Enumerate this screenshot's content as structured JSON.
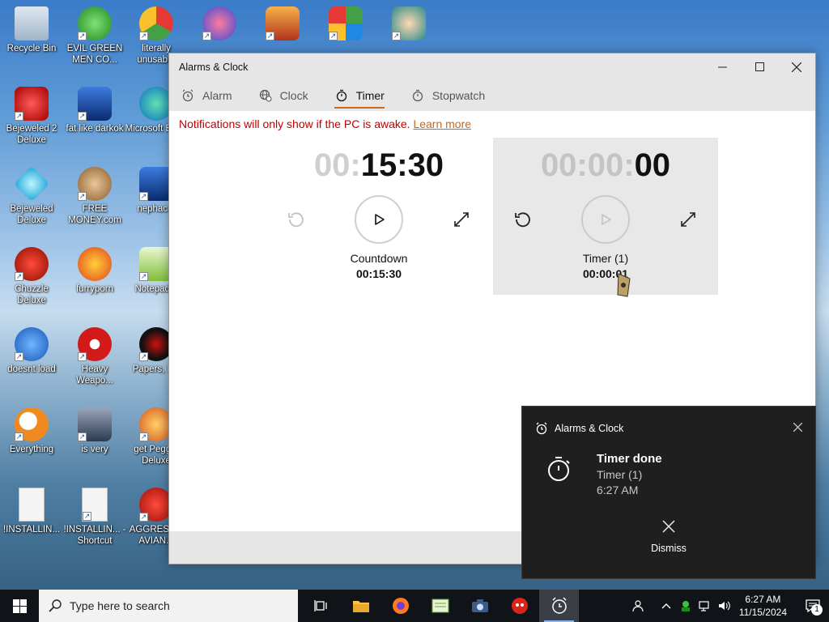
{
  "desktop": {
    "icons": [
      {
        "label": "Recycle Bin"
      },
      {
        "label": "EVIL GREEN MEN CO..."
      },
      {
        "label": "literally unusab..."
      },
      {
        "label": "Bejeweled 2 Deluxe"
      },
      {
        "label": "fat like darkok"
      },
      {
        "label": "Microsoft Edge"
      },
      {
        "label": "Bejeweled Deluxe"
      },
      {
        "label": "FREE MONEY.com"
      },
      {
        "label": "nephac..."
      },
      {
        "label": "Chuzzle Deluxe"
      },
      {
        "label": "furryporn"
      },
      {
        "label": "Notepad..."
      },
      {
        "label": "doesnt load"
      },
      {
        "label": "Heavy Weapo..."
      },
      {
        "label": "Papers, P..."
      },
      {
        "label": "Everything"
      },
      {
        "label": "is very"
      },
      {
        "label": "get Pegg... Deluxe"
      },
      {
        "label": "!INSTALLIN..."
      },
      {
        "label": "!INSTALLIN... - Shortcut"
      },
      {
        "label": "AGGRESS... AVIAN..."
      }
    ]
  },
  "window": {
    "title": "Alarms & Clock",
    "tabs": [
      {
        "label": "Alarm",
        "icon": "alarm-icon"
      },
      {
        "label": "Clock",
        "icon": "globe-icon"
      },
      {
        "label": "Timer",
        "icon": "timer-icon",
        "active": true
      },
      {
        "label": "Stopwatch",
        "icon": "stopwatch-icon"
      }
    ],
    "notice": "Notifications will only show if the PC is awake.",
    "learn_more": "Learn more",
    "timers": [
      {
        "time_dim": "00:",
        "time_bright": "15:30",
        "name": "Countdown",
        "small": "00:15:30"
      },
      {
        "time_dim": "00:00:",
        "time_bright": "00",
        "name": "Timer (1)",
        "small": "00:00:01"
      }
    ]
  },
  "toast": {
    "app": "Alarms & Clock",
    "title": "Timer done",
    "line1": "Timer (1)",
    "line2": "6:27 AM",
    "dismiss": "Dismiss"
  },
  "taskbar": {
    "search_placeholder": "Type here to search",
    "time": "6:27 AM",
    "date": "11/15/2024",
    "notification_count": "1"
  },
  "colors": {
    "accent": "#c9671a",
    "warning_text": "#c00000",
    "toast_bg": "#1f1f1f",
    "taskbar_bg": "#101418"
  }
}
